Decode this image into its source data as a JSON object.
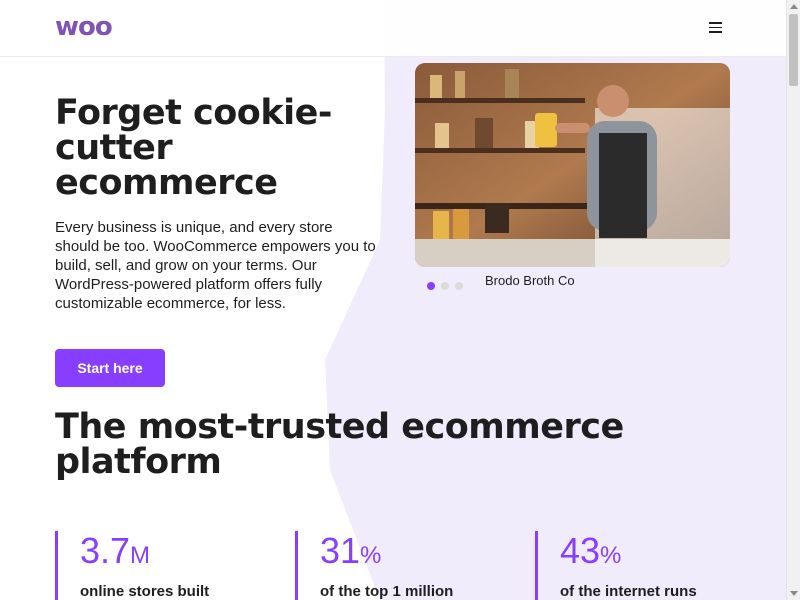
{
  "header": {
    "logo": "woo",
    "menu_icon": "hamburger-menu-icon"
  },
  "hero": {
    "title": "Forget cookie-cutter ecommerce",
    "description": "Every business is unique, and every store should be too. WooCommerce empowers you to build, sell, and grow on your terms. Our WordPress-powered platform offers fully customizable ecommerce, for less.",
    "cta_label": "Start here",
    "carousel": {
      "caption": "Brodo Broth Co",
      "slide_count": 3,
      "active_slide": 1
    }
  },
  "trusted": {
    "title": "The most-trusted ecommerce platform",
    "stats": [
      {
        "value": "3.7",
        "unit": "M",
        "label": "online stores built"
      },
      {
        "value": "31",
        "unit": "%",
        "label": "of the top 1 million"
      },
      {
        "value": "43",
        "unit": "%",
        "label": "of the internet runs"
      }
    ]
  },
  "colors": {
    "brand": "#7f54b3",
    "accent": "#873eff",
    "blob": "#f0ecfc",
    "text": "#1e1e1e"
  }
}
